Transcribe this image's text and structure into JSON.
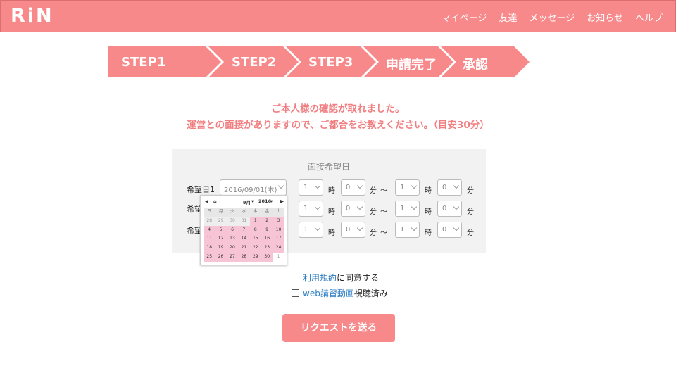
{
  "header": {
    "logo": "RiN",
    "nav": [
      "マイページ",
      "友達",
      "メッセージ",
      "お知らせ",
      "ヘルプ"
    ]
  },
  "steps": [
    "STEP1",
    "STEP2",
    "STEP3",
    "申請完了",
    "承認"
  ],
  "message": {
    "line1": "ご本人様の確認が取れました。",
    "line2": "運営との面接がありますので、ご都合をお教えください。（目安30分）"
  },
  "form": {
    "title": "面接希望日",
    "rows": [
      {
        "label": "希望日1",
        "date": "2016/09/01(木)",
        "start_hour": "1",
        "start_min": "0",
        "end_hour": "1",
        "end_min": "0"
      },
      {
        "label": "希望",
        "date": "",
        "start_hour": "1",
        "start_min": "0",
        "end_hour": "1",
        "end_min": "0"
      },
      {
        "label": "希望",
        "date": "",
        "start_hour": "1",
        "start_min": "0",
        "end_hour": "1",
        "end_min": "0"
      }
    ],
    "units": {
      "hour": "時",
      "minute": "分",
      "tilde": "〜"
    }
  },
  "calendar": {
    "month": "9月",
    "year": "2016",
    "weekdays": [
      "日",
      "月",
      "火",
      "水",
      "木",
      "金",
      "土"
    ],
    "weeks": [
      [
        "28",
        "29",
        "30",
        "31",
        "1",
        "2",
        "3"
      ],
      [
        "4",
        "5",
        "6",
        "7",
        "8",
        "9",
        "10"
      ],
      [
        "11",
        "12",
        "13",
        "14",
        "15",
        "16",
        "17"
      ],
      [
        "18",
        "19",
        "20",
        "21",
        "22",
        "23",
        "24"
      ],
      [
        "25",
        "26",
        "27",
        "28",
        "29",
        "30",
        "1"
      ]
    ],
    "prev_month_days": 4,
    "next_month_days": 1
  },
  "agreements": [
    {
      "link": "利用規約",
      "text": "に同意する"
    },
    {
      "link": "web講習動画",
      "text": "視聴済み"
    }
  ],
  "submit_label": "リクエストを送る",
  "colors": {
    "accent": "#f7898a",
    "message": "#f07e80",
    "link": "#2a7bc0",
    "calendar_highlight": "#f7c4d6"
  }
}
